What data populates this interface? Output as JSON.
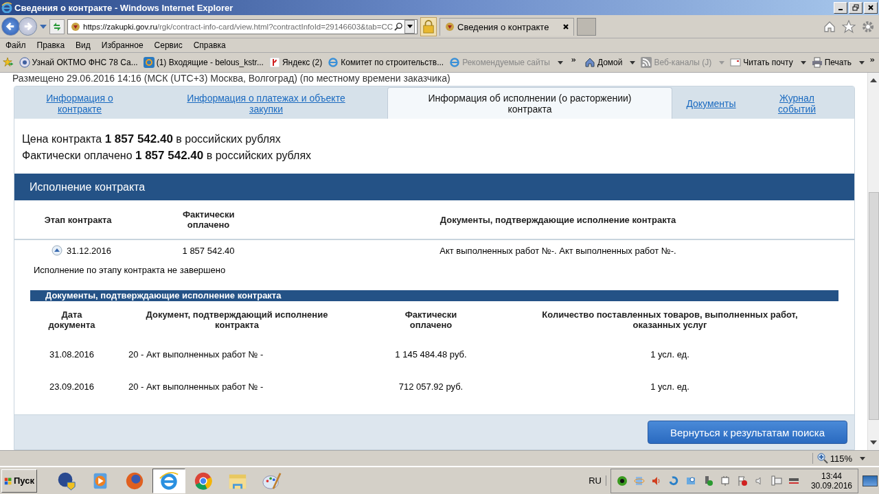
{
  "window": {
    "title": "Сведения о контракте - Windows Internet Explorer"
  },
  "address_bar": {
    "host": "https://zakupki.gov.ru",
    "path": "/rgk/contract-info-card/view.html?contractInfoId=29146603&tab=CC"
  },
  "browser_tabs": [
    {
      "label": "Сведения о контракте",
      "selected": true
    }
  ],
  "menu": [
    "Файл",
    "Правка",
    "Вид",
    "Избранное",
    "Сервис",
    "Справка"
  ],
  "favorites": [
    {
      "label": "Узнай ОКТМО  ФНС  78 Са...",
      "kind": "emblem",
      "disabled": false
    },
    {
      "label": "(1) Входящие - belous_kstr...",
      "kind": "mail",
      "disabled": false
    },
    {
      "label": "Яндекс (2)",
      "kind": "yandex",
      "disabled": false
    },
    {
      "label": "Комитет по строительств...",
      "kind": "ie",
      "disabled": false
    },
    {
      "label": "Рекомендуемые сайты",
      "kind": "ie",
      "disabled": true
    }
  ],
  "command_bar": [
    {
      "label": "Домой",
      "kind": "home",
      "disabled": false
    },
    {
      "label": "Веб-каналы (J)",
      "kind": "feed",
      "disabled": true
    },
    {
      "label": "Читать почту",
      "kind": "mail",
      "disabled": false
    },
    {
      "label": "Печать",
      "kind": "print",
      "disabled": false
    }
  ],
  "page": {
    "posted_line": "Размещено 29.06.2016 14:16 (МСК (UTC+3) Москва, Волгоград) (по местному времени заказчика)",
    "tabs": [
      {
        "label": "Информация о контракте",
        "selected": false
      },
      {
        "label": "Информация о платежах и объекте закупки",
        "selected": false
      },
      {
        "label": "Информация об исполнении (о расторжении) контракта",
        "selected": true
      },
      {
        "label": "Документы",
        "selected": false
      },
      {
        "label": "Журнал событий",
        "selected": false
      }
    ],
    "price_lines": [
      "Цена контракта **1 857 542.40** в российских рублях",
      "Фактически оплачено **1 857 542.40** в российских рублях"
    ],
    "execution": {
      "title": "Исполнение контракта",
      "columns": [
        "Этап контракта",
        "Фактически оплачено",
        "Документы, подтверждающие исполнение контракта"
      ],
      "stages": [
        {
          "date": "31.12.2016",
          "paid": "1 857 542.40",
          "documents": "Акт выполненных работ №-. Акт выполненных работ №-.",
          "expanded": true
        }
      ],
      "stage_status": "Исполнение по этапу контракта не завершено",
      "docs_title": "Документы, подтверждающие исполнение контракта",
      "doc_columns": [
        "Дата документа",
        "Документ, подтверждающий исполнение контракта",
        "Фактически оплачено",
        "Количество поставленных товаров, выполненных работ, оказанных услуг"
      ],
      "doc_rows": [
        [
          "31.08.2016",
          "20 - Акт выполненных работ № -",
          "1 145 484.48 руб.",
          "1 усл. ед."
        ],
        [
          "23.09.2016",
          "20 - Акт выполненных работ № -",
          "712 057.92 руб.",
          "1 усл. ед."
        ]
      ]
    },
    "return_button": "Вернуться к результатам поиска"
  },
  "status_bar": {
    "zoom": "115%"
  },
  "taskbar": {
    "start": "Пуск",
    "apps": [
      {
        "kind": "shield",
        "selected": false
      },
      {
        "kind": "player",
        "selected": false
      },
      {
        "kind": "fox",
        "selected": false
      },
      {
        "kind": "ie",
        "selected": true
      },
      {
        "kind": "chrome",
        "selected": false
      },
      {
        "kind": "folder",
        "selected": false
      },
      {
        "kind": "paint",
        "selected": false
      }
    ],
    "language": "RU",
    "time": "13:44",
    "date": "30.09.2016"
  }
}
